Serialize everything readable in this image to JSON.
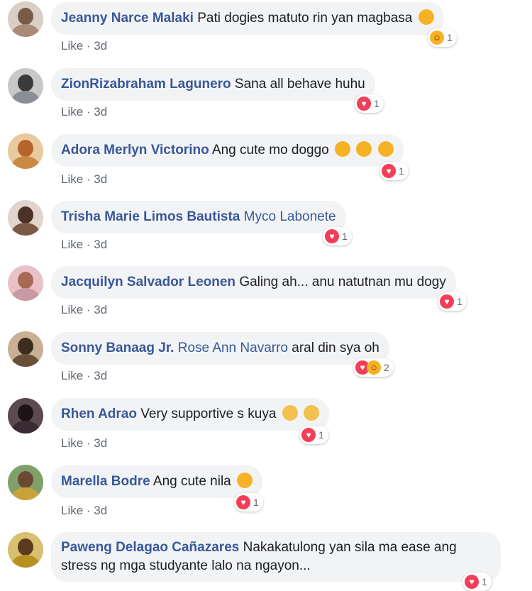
{
  "comments": [
    {
      "author": "Jeanny Narce Malaki",
      "text": "Pati dogies matuto rin yan magbasa",
      "emoji": "laughing-emoji",
      "like": "Like",
      "time": "3d",
      "reaction_types": [
        "haha"
      ],
      "reaction_count": "1",
      "avatar": "#a98b78"
    },
    {
      "author": "ZionRizabraham Lagunero",
      "text": "Sana all behave huhu",
      "emoji": "",
      "like": "Like",
      "time": "3d",
      "reaction_types": [
        "love"
      ],
      "reaction_count": "1",
      "avatar": "#8a8f95"
    },
    {
      "author": "Adora Merlyn Victorino",
      "text": "Ang cute mo doggo",
      "emoji": "smiling-emoji x3",
      "like": "Like",
      "time": "3d",
      "reaction_types": [
        "love"
      ],
      "reaction_count": "1",
      "avatar": "#c98a45"
    },
    {
      "author": "Trisha Marie Limos Bautista",
      "tag": "Myco Labonete",
      "text": "",
      "like": "Like",
      "time": "3d",
      "reaction_types": [
        "love"
      ],
      "reaction_count": "1",
      "avatar": "#7a5a45"
    },
    {
      "author": "Jacquilyn Salvador Leonen",
      "text": "Galing ah... anu natutnan mu dogy",
      "like": "Like",
      "time": "3d",
      "reaction_types": [
        "love"
      ],
      "reaction_count": "1",
      "avatar": "#c79aa5"
    },
    {
      "author": "Sonny Banaag Jr.",
      "tag": "Rose Ann Navarro",
      "text": "aral din sya oh",
      "like": "Like",
      "time": "3d",
      "reaction_types": [
        "love",
        "haha"
      ],
      "reaction_count": "2",
      "avatar": "#6b5038"
    },
    {
      "author": "Rhen Adrao",
      "text": "Very supportive s kuya",
      "emoji": "clapping-hands-emoji x2",
      "like": "Like",
      "time": "3d",
      "reaction_types": [
        "love"
      ],
      "reaction_count": "1",
      "avatar": "#3a2a32"
    },
    {
      "author": "Marella Bodre",
      "text": "Ang cute nila",
      "emoji": "heart-eyes-emoji",
      "like": "Like",
      "time": "3d",
      "reaction_types": [
        "love"
      ],
      "reaction_count": "1",
      "avatar": "#c9a23a"
    },
    {
      "author": "Paweng Delagao Cañazares",
      "text": "Nakakatulong yan sila ma ease ang stress ng mga studyante lalo na ngayon...",
      "like": "",
      "time": "",
      "reaction_types": [
        "love"
      ],
      "reaction_count": "1",
      "avatar": "#b89020"
    }
  ],
  "colors": {
    "author": "#385898",
    "bubble": "#f2f3f5",
    "meta": "#606770",
    "love": "#f33e58",
    "haha": "#f7b125"
  }
}
